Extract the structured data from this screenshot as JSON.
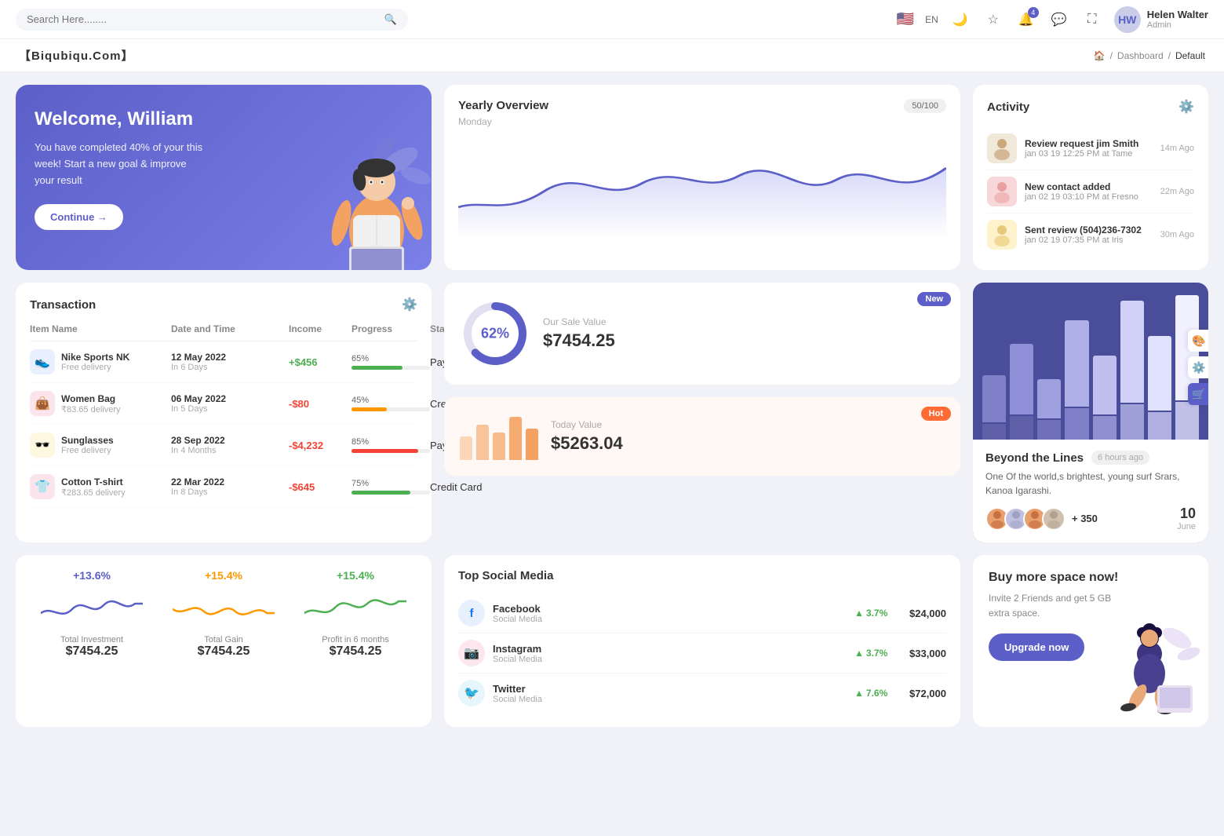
{
  "navbar": {
    "search_placeholder": "Search Here........",
    "language": "EN",
    "user": {
      "name": "Helen Walter",
      "role": "Admin",
      "initials": "HW"
    },
    "notification_count": "4"
  },
  "brand": {
    "name": "【Biqubiqu.Com】"
  },
  "breadcrumb": {
    "home": "🏠",
    "separator": "/",
    "dashboard": "Dashboard",
    "default": "Default"
  },
  "welcome": {
    "title": "Welcome, William",
    "subtitle": "You have completed 40% of your this week! Start a new goal & improve your result",
    "button": "Continue →"
  },
  "yearly_overview": {
    "title": "Yearly Overview",
    "subtitle": "Monday",
    "badge": "50/100"
  },
  "activity": {
    "title": "Activity",
    "items": [
      {
        "title": "Review request jim Smith",
        "sub": "jan 03 19 12:25 PM at Tame",
        "time": "14m Ago"
      },
      {
        "title": "New contact added",
        "sub": "jan 02 19 03:10 PM at Fresno",
        "time": "22m Ago"
      },
      {
        "title": "Sent review (504)236-7302",
        "sub": "jan 02 19 07:35 PM at Iris",
        "time": "30m Ago"
      }
    ]
  },
  "transaction": {
    "title": "Transaction",
    "columns": [
      "Item Name",
      "Date and Time",
      "Income",
      "Progress",
      "Status"
    ],
    "rows": [
      {
        "icon": "👟",
        "icon_bg": "#e8f0fe",
        "name": "Nike Sports NK",
        "sub": "Free delivery",
        "date": "12 May 2022",
        "date_sub": "In 6 Days",
        "income": "+$456",
        "income_type": "pos",
        "progress": 65,
        "progress_color": "#4caf50",
        "status": "Paypal"
      },
      {
        "icon": "👜",
        "icon_bg": "#fce4ec",
        "name": "Women Bag",
        "sub": "₹83.65 delivery",
        "date": "06 May 2022",
        "date_sub": "In 5 Days",
        "income": "-$80",
        "income_type": "neg",
        "progress": 45,
        "progress_color": "#ff9800",
        "status": "Credit Card"
      },
      {
        "icon": "🕶️",
        "icon_bg": "#fff8e1",
        "name": "Sunglasses",
        "sub": "Free delivery",
        "date": "28 Sep 2022",
        "date_sub": "In 4 Months",
        "income": "-$4,232",
        "income_type": "neg",
        "progress": 85,
        "progress_color": "#f44336",
        "status": "Paypal"
      },
      {
        "icon": "👕",
        "icon_bg": "#fce4ec",
        "name": "Cotton T-shirt",
        "sub": "₹283.65 delivery",
        "date": "22 Mar 2022",
        "date_sub": "In 8 Days",
        "income": "-$645",
        "income_type": "neg",
        "progress": 75,
        "progress_color": "#4caf50",
        "status": "Credit Card"
      }
    ]
  },
  "sale_value": {
    "badge": "New",
    "donut_pct": "62%",
    "title": "Our Sale Value",
    "value": "$7454.25"
  },
  "today_value": {
    "badge": "Hot",
    "title": "Today Value",
    "value": "$5263.04"
  },
  "beyond": {
    "title": "Beyond the Lines",
    "time": "6 hours ago",
    "desc": "One Of the world,s brightest, young surf Srars, Kanoa Igarashi.",
    "plus_count": "+ 350",
    "date_num": "10",
    "date_month": "June"
  },
  "stats": [
    {
      "pct": "+13.6%",
      "color": "purple",
      "label": "Total Investment",
      "value": "$7454.25"
    },
    {
      "pct": "+15.4%",
      "color": "orange",
      "label": "Total Gain",
      "value": "$7454.25"
    },
    {
      "pct": "+15.4%",
      "color": "green",
      "label": "Profit in 6 months",
      "value": "$7454.25"
    }
  ],
  "social_media": {
    "title": "Top Social Media",
    "items": [
      {
        "name": "Facebook",
        "type": "Social Media",
        "pct": "3.7%",
        "amount": "$24,000",
        "icon": "f",
        "color": "#1877f2",
        "bg": "#e7f0fd"
      },
      {
        "name": "Instagram",
        "type": "Social Media",
        "pct": "3.7%",
        "amount": "$33,000",
        "icon": "📷",
        "color": "#e1306c",
        "bg": "#fde7ef"
      },
      {
        "name": "Twitter",
        "type": "Social Media",
        "pct": "7.6%",
        "amount": "$72,000",
        "icon": "🐦",
        "color": "#1da1f2",
        "bg": "#e7f5fd"
      }
    ]
  },
  "buy_space": {
    "title": "Buy more space now!",
    "desc": "Invite 2 Friends and get 5 GB extra space.",
    "button": "Upgrade now"
  }
}
